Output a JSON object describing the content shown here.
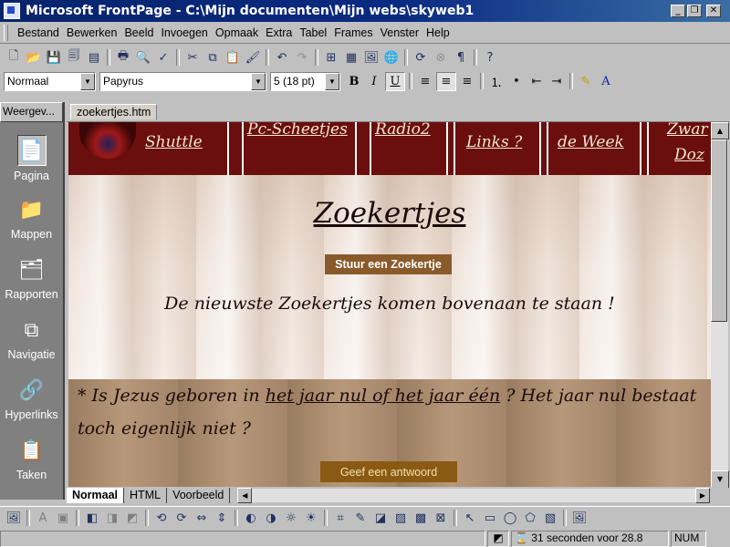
{
  "window": {
    "title": "Microsoft FrontPage - C:\\Mijn documenten\\Mijn webs\\skyweb1"
  },
  "menu": [
    "Bestand",
    "Bewerken",
    "Beeld",
    "Invoegen",
    "Opmaak",
    "Extra",
    "Tabel",
    "Frames",
    "Venster",
    "Help"
  ],
  "format": {
    "style": "Normaal",
    "font": "Papyrus",
    "size": "5 (18 pt)"
  },
  "views": {
    "header": "Weergev...",
    "items": [
      {
        "label": "Pagina",
        "icon": "page-icon"
      },
      {
        "label": "Mappen",
        "icon": "folder-icon"
      },
      {
        "label": "Rapporten",
        "icon": "reports-icon"
      },
      {
        "label": "Navigatie",
        "icon": "navigation-icon"
      },
      {
        "label": "Hyperlinks",
        "icon": "hyperlinks-icon"
      },
      {
        "label": "Taken",
        "icon": "tasks-icon"
      }
    ]
  },
  "document": {
    "tab": "zoekertjes.htm"
  },
  "page": {
    "nav": [
      "Shuttle",
      "Pc-Scheetjes",
      "Radio2",
      "Links ?",
      "de Week",
      "Zwar",
      "Doz"
    ],
    "heading": "Zoekertjes",
    "submit_button": "Stuur een Zoekertje",
    "newest_note": "De nieuwste Zoekertjes komen bovenaan te staan !",
    "question_pre": "* Is Jezus geboren in ",
    "question_link": "het jaar nul of het jaar één",
    "question_post": " ? Het jaar nul bestaat toch eigenlijk niet ?",
    "answer_button": "Geef een antwoord"
  },
  "view_tabs": [
    "Normaal",
    "HTML",
    "Voorbeeld"
  ],
  "status": {
    "download": "31 seconden voor 28.8",
    "mode": "NUM"
  }
}
